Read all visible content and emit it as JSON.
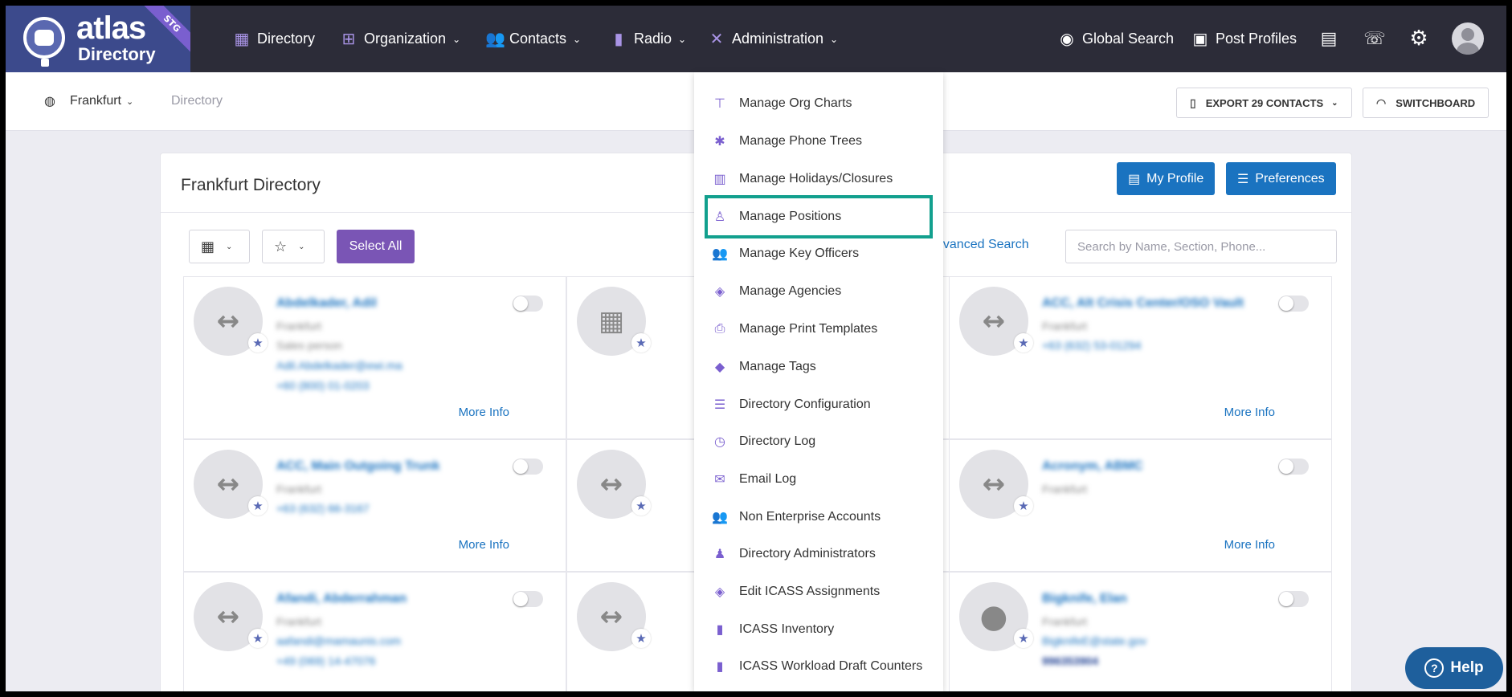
{
  "app": {
    "logo_title": "atlas",
    "logo_subtitle": "Directory",
    "env_badge": "STG"
  },
  "nav": {
    "items": [
      {
        "label": "Directory",
        "icon": "directory-icon"
      },
      {
        "label": "Organization",
        "icon": "org-chart-icon"
      },
      {
        "label": "Contacts",
        "icon": "contacts-icon"
      },
      {
        "label": "Radio",
        "icon": "radio-icon"
      },
      {
        "label": "Administration",
        "icon": "tools-icon"
      }
    ],
    "global_search": "Global Search",
    "post_profiles": "Post Profiles"
  },
  "subbar": {
    "location": "Frankfurt",
    "breadcrumb": "Directory",
    "export_label": "EXPORT 29 CONTACTS",
    "switchboard_label": "SWITCHBOARD"
  },
  "card": {
    "title": "Frankfurt Directory",
    "my_profile": "My Profile",
    "preferences": "Preferences",
    "select_all": "Select All",
    "advanced_search": "dvanced Search",
    "search_placeholder": "Search by Name, Section, Phone..."
  },
  "contacts": [
    {
      "name": "Abdelkader, Adil",
      "lines": [
        "Frankfurt",
        "Sales person",
        "Adil.Abdelkader@ewi.ma",
        "+60 (800) 01-0203"
      ],
      "more": "More Info"
    },
    {
      "name": "",
      "lines": [],
      "more": ""
    },
    {
      "name": "ACC, Alt Crisis Center/OSO Vault",
      "lines": [
        "Frankfurt",
        "+63 (632) 53-01294"
      ],
      "more": "More Info"
    },
    {
      "name": "ACC, Main Outgoing Trunk",
      "lines": [
        "Frankfurt",
        "+63 (632) 66-3167"
      ],
      "more": "More Info"
    },
    {
      "name": "",
      "lines": [],
      "more": ""
    },
    {
      "name": "Acronym, ABMC",
      "lines": [
        "Frankfurt"
      ],
      "more": "More Info"
    },
    {
      "name": "Afandi, Abderrahman",
      "lines": [
        "Frankfurt",
        "aafandi@mamaunis.com",
        "+49 (069) 14-47076"
      ],
      "more": ""
    },
    {
      "name": "",
      "lines": [],
      "more": ""
    },
    {
      "name": "Bigknife, Elan",
      "lines": [
        "Frankfurt",
        "BigknifeE@state.gov",
        "996353904"
      ],
      "more": ""
    }
  ],
  "admin_menu": [
    {
      "label": "Manage Org Charts",
      "icon": "sitemap-icon"
    },
    {
      "label": "Manage Phone Trees",
      "icon": "network-icon"
    },
    {
      "label": "Manage Holidays/Closures",
      "icon": "building-calendar-icon"
    },
    {
      "label": "Manage Positions",
      "icon": "person-position-icon",
      "highlighted": true
    },
    {
      "label": "Manage Key Officers",
      "icon": "users-icon"
    },
    {
      "label": "Manage Agencies",
      "icon": "layers-icon"
    },
    {
      "label": "Manage Print Templates",
      "icon": "printer-icon"
    },
    {
      "label": "Manage Tags",
      "icon": "tags-icon"
    },
    {
      "label": "Directory Configuration",
      "icon": "sliders-icon"
    },
    {
      "label": "Directory Log",
      "icon": "clock-icon"
    },
    {
      "label": "Email Log",
      "icon": "envelope-icon"
    },
    {
      "label": "Non Enterprise Accounts",
      "icon": "users-group-icon"
    },
    {
      "label": "Directory Administrators",
      "icon": "user-shield-icon"
    },
    {
      "label": "Edit ICASS Assignments",
      "icon": "layers-icon"
    },
    {
      "label": "ICASS Inventory",
      "icon": "mobile-icon"
    },
    {
      "label": "ICASS Workload Draft Counters",
      "icon": "mobile-icon"
    }
  ],
  "help_label": "Help",
  "colors": {
    "nav_bg": "#2c2c38",
    "accent_purple": "#7a55b5",
    "primary_blue": "#1a73c0",
    "highlight_teal": "#12a08e"
  }
}
